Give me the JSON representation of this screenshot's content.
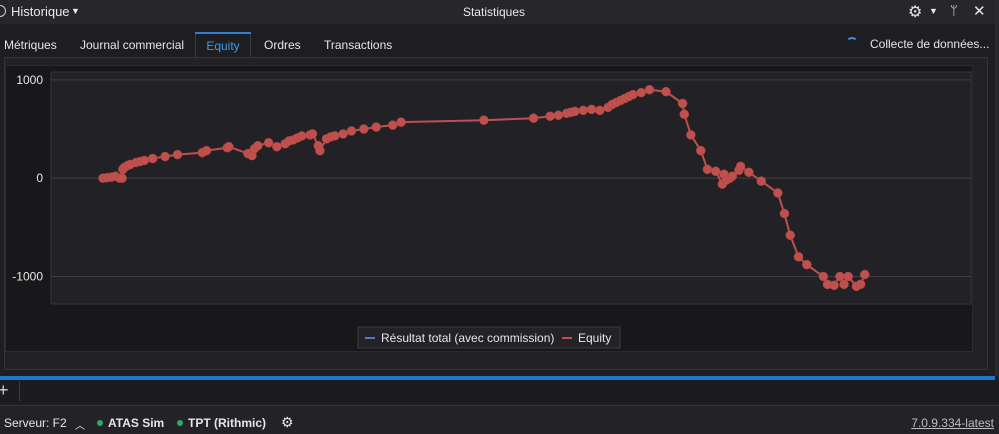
{
  "titlebar": {
    "history_label": "Historique",
    "window_title": "Statistiques",
    "icons": {
      "gear": "gear-icon",
      "pin": "pin-icon",
      "close": "close-icon"
    }
  },
  "tabs": [
    {
      "label": "Métriques",
      "active": false
    },
    {
      "label": "Journal commercial",
      "active": false
    },
    {
      "label": "Equity",
      "active": true
    },
    {
      "label": "Ordres",
      "active": false
    },
    {
      "label": "Transactions",
      "active": false
    }
  ],
  "collect_label": "Collecte de données...",
  "status_bar": {
    "server_label": "Serveur: F2",
    "connections": [
      {
        "label": "ATAS Sim",
        "color": "#2fa86a"
      },
      {
        "label": "TPT (Rithmic)",
        "color": "#2fa86a"
      }
    ],
    "version": "7.0.9.334-latest"
  },
  "chart_data": {
    "type": "line",
    "yticks": [
      1000,
      0,
      -1000
    ],
    "ylim": [
      -1280,
      1080
    ],
    "xlim": [
      0,
      100
    ],
    "grid": true,
    "legend_position": "bottom-center",
    "series": [
      {
        "name": "Résultat total (avec commission)",
        "color": "#4a7fc8",
        "x": [],
        "y": []
      },
      {
        "name": "Equity",
        "color": "#c0504d",
        "x": [
          0,
          0.5,
          1,
          1.5,
          2,
          2.3,
          2.4,
          2.6,
          3,
          3.3,
          4,
          4.5,
          5,
          6,
          7.5,
          9,
          12,
          12.5,
          15,
          15.2,
          17.5,
          18,
          18.3,
          18.7,
          20,
          21,
          22,
          22.5,
          23,
          23.5,
          24,
          25,
          25.3,
          26,
          26.2,
          27,
          27.5,
          28,
          29,
          30,
          31.5,
          33,
          35,
          36,
          46,
          52,
          54,
          55,
          56,
          56.5,
          57,
          58,
          59,
          60,
          61,
          61.5,
          62,
          62.5,
          63,
          63.5,
          64,
          65,
          66,
          68,
          70,
          70.2,
          71,
          72.2,
          73,
          74,
          74.8,
          75,
          75.3,
          75.7,
          76,
          76.8,
          77,
          78,
          79.5,
          81.5,
          82.3,
          83,
          84,
          85,
          87,
          87.5,
          88.3,
          89,
          89.5,
          90,
          91,
          91.5,
          92
        ],
        "y": [
          0,
          5,
          10,
          20,
          0,
          0,
          90,
          110,
          130,
          140,
          160,
          170,
          180,
          200,
          220,
          240,
          260,
          280,
          310,
          320,
          250,
          230,
          300,
          330,
          360,
          320,
          350,
          380,
          390,
          410,
          430,
          440,
          450,
          330,
          280,
          400,
          420,
          430,
          450,
          480,
          500,
          520,
          540,
          570,
          590,
          610,
          630,
          640,
          660,
          670,
          680,
          690,
          700,
          690,
          720,
          750,
          770,
          790,
          810,
          830,
          850,
          870,
          900,
          880,
          760,
          650,
          440,
          280,
          90,
          70,
          -60,
          40,
          -20,
          0,
          20,
          80,
          120,
          60,
          -30,
          -150,
          -360,
          -580,
          -800,
          -880,
          -1000,
          -1080,
          -1090,
          -1000,
          -1080,
          -1000,
          -1100,
          -1080,
          -980
        ]
      }
    ]
  }
}
